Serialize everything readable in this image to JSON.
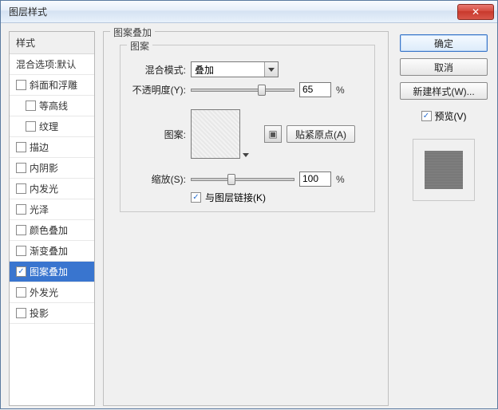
{
  "window": {
    "title": "图层样式",
    "close_glyph": "✕"
  },
  "sidebar": {
    "header": "样式",
    "items": [
      {
        "label": "混合选项:默认",
        "has_checkbox": false,
        "checked": false,
        "indent": false,
        "selected": false
      },
      {
        "label": "斜面和浮雕",
        "has_checkbox": true,
        "checked": false,
        "indent": false,
        "selected": false
      },
      {
        "label": "等高线",
        "has_checkbox": true,
        "checked": false,
        "indent": true,
        "selected": false
      },
      {
        "label": "纹理",
        "has_checkbox": true,
        "checked": false,
        "indent": true,
        "selected": false
      },
      {
        "label": "描边",
        "has_checkbox": true,
        "checked": false,
        "indent": false,
        "selected": false
      },
      {
        "label": "内阴影",
        "has_checkbox": true,
        "checked": false,
        "indent": false,
        "selected": false
      },
      {
        "label": "内发光",
        "has_checkbox": true,
        "checked": false,
        "indent": false,
        "selected": false
      },
      {
        "label": "光泽",
        "has_checkbox": true,
        "checked": false,
        "indent": false,
        "selected": false
      },
      {
        "label": "颜色叠加",
        "has_checkbox": true,
        "checked": false,
        "indent": false,
        "selected": false
      },
      {
        "label": "渐变叠加",
        "has_checkbox": true,
        "checked": false,
        "indent": false,
        "selected": false
      },
      {
        "label": "图案叠加",
        "has_checkbox": true,
        "checked": true,
        "indent": false,
        "selected": true
      },
      {
        "label": "外发光",
        "has_checkbox": true,
        "checked": false,
        "indent": false,
        "selected": false
      },
      {
        "label": "投影",
        "has_checkbox": true,
        "checked": false,
        "indent": false,
        "selected": false
      }
    ]
  },
  "group": {
    "title": "图案叠加",
    "pattern_title": "图案",
    "blend_label": "混合模式:",
    "blend_value": "叠加",
    "opacity_label": "不透明度(Y):",
    "opacity_value": "65",
    "opacity_unit": "%",
    "pattern_label": "图案:",
    "snap_label": "贴紧原点(A)",
    "snap_icon_glyph": "▣",
    "scale_label": "缩放(S):",
    "scale_value": "100",
    "scale_unit": "%",
    "link_label": "与图层链接(K)",
    "link_checked": true
  },
  "right": {
    "ok": "确定",
    "cancel": "取消",
    "new_style": "新建样式(W)...",
    "preview_label": "预览(V)",
    "preview_checked": true
  },
  "slider": {
    "opacity_pos_pct": 65,
    "scale_pos_pct": 35
  }
}
